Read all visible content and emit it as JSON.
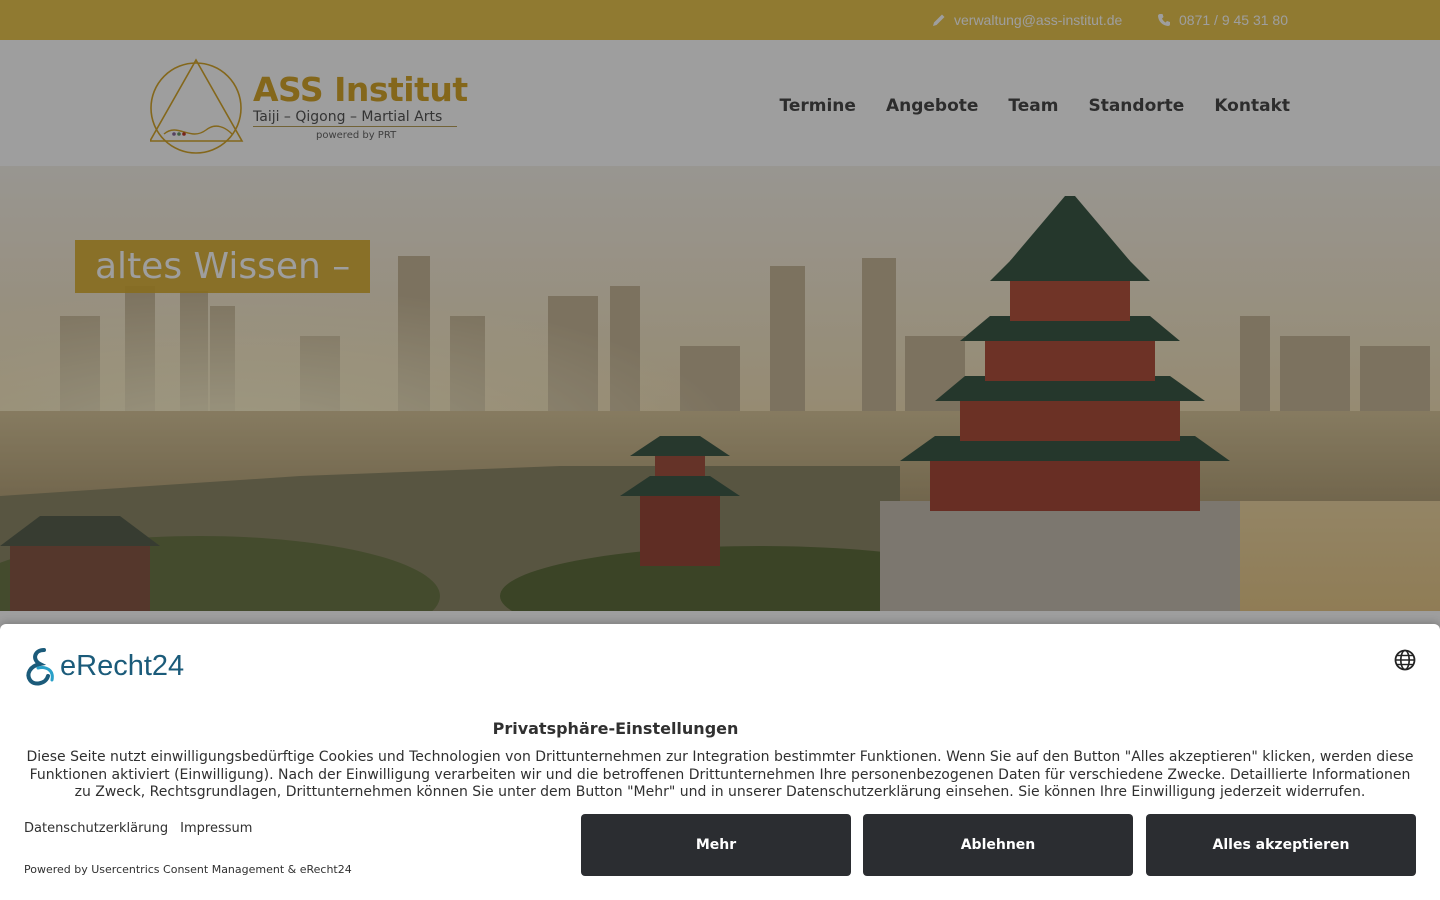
{
  "topbar": {
    "email": "verwaltung@ass-institut.de",
    "phone": "0871 / 9 45 31 80"
  },
  "logo": {
    "title": "ASS Institut",
    "subtitle": "Taiji – Qigong – Martial Arts",
    "powered": "powered by PRT"
  },
  "nav": {
    "items": [
      {
        "label": "Termine"
      },
      {
        "label": "Angebote"
      },
      {
        "label": "Team"
      },
      {
        "label": "Standorte"
      },
      {
        "label": "Kontakt"
      }
    ]
  },
  "hero": {
    "tagline": "altes Wissen –"
  },
  "consent": {
    "brand": "eRecht24",
    "title": "Privatsphäre-Einstellungen",
    "text": "Diese Seite nutzt einwilligungsbedürftige Cookies und Technologien von Drittunternehmen zur Integration bestimmter Funktionen. Wenn Sie auf den Button \"Alles akzeptieren\" klicken, werden diese Funktionen aktiviert (Einwilligung). Nach der Einwilligung verarbeiten wir und die betroffenen Drittunternehmen Ihre personenbezogenen Daten für verschiedene Zwecke. Detaillierte Informationen zu Zweck, Rechtsgrundlagen, Drittunternehmen können Sie unter dem Button \"Mehr\" und in unserer Datenschutzerklärung einsehen. Sie können Ihre Einwilligung jederzeit widerrufen.",
    "link_privacy": "Datenschutzerklärung",
    "link_imprint": "Impressum",
    "powered": "Powered by Usercentrics Consent Management & eRecht24",
    "btn_more": "Mehr",
    "btn_deny": "Ablehnen",
    "btn_accept": "Alles akzeptieren"
  },
  "colors": {
    "gold": "#e9c64f",
    "logo_gold": "#d6a72d",
    "button_dark": "#2b2d31",
    "brand_teal": "#1b5b7a"
  }
}
